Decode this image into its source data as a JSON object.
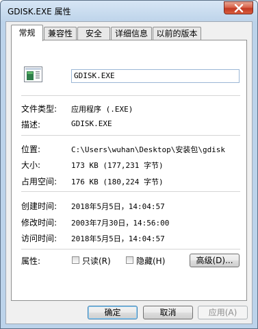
{
  "window": {
    "title": "GDISK.EXE 属性"
  },
  "tabs": [
    {
      "label": "常规"
    },
    {
      "label": "兼容性"
    },
    {
      "label": "安全"
    },
    {
      "label": "详细信息"
    },
    {
      "label": "以前的版本"
    }
  ],
  "general": {
    "file_name": "GDISK.EXE",
    "file_type_label": "文件类型:",
    "file_type_value": "应用程序 (.EXE)",
    "description_label": "描述:",
    "description_value": "GDISK.EXE",
    "location_label": "位置:",
    "location_value": "C:\\Users\\wuhan\\Desktop\\安装包\\gdisk",
    "size_label": "大小:",
    "size_value": "173 KB (177,231 字节)",
    "size_on_disk_label": "占用空间:",
    "size_on_disk_value": "176 KB (180,224 字节)",
    "created_label": "创建时间:",
    "created_value": "2018年5月5日，14:04:57",
    "modified_label": "修改时间:",
    "modified_value": "2003年7月30日，14:56:00",
    "accessed_label": "访问时间:",
    "accessed_value": "2018年5月5日，14:04:57",
    "attributes_label": "属性:",
    "readonly_label": "只读(R)",
    "hidden_label": "隐藏(H)",
    "advanced_label": "高级(D)...",
    "readonly_checked": false,
    "hidden_checked": false
  },
  "footer": {
    "ok_label": "确定",
    "cancel_label": "取消",
    "apply_label": "应用(A)"
  },
  "icons": {
    "close": "close-icon",
    "file": "exe-file-icon"
  }
}
